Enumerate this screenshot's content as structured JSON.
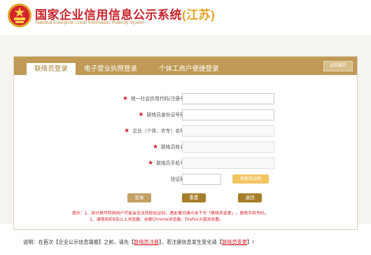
{
  "header": {
    "title_main": "国家企业信用信息公示系统",
    "title_province": "(江苏)",
    "subtitle_en": "National Enterprise Credit Information Publicity System"
  },
  "tabs": [
    {
      "label": "联络员登录"
    },
    {
      "label": "电子营业执照登录"
    },
    {
      "label": "个体工商户便捷登录"
    }
  ],
  "home_button": "返回首页",
  "form": {
    "fields": [
      {
        "label": "统一社会信用代码/注册号",
        "required": true,
        "value": ""
      },
      {
        "label": "联络员身份证号码",
        "required": true,
        "value": ""
      },
      {
        "label": "企业（个体、农专）名称",
        "required": true,
        "value": ""
      },
      {
        "label": "联络员姓名",
        "required": true,
        "value": ""
      },
      {
        "label": "联络员手机号",
        "required": true,
        "value": ""
      }
    ],
    "captcha_label": "验证码",
    "captcha_value": "",
    "get_code_button": "获取验证码",
    "required_mark": "★"
  },
  "actions": {
    "login": "登录",
    "reset": "重置",
    "back": "返回"
  },
  "tips": {
    "line1": "提示：1、部分携号转网用户可能会无法获取验证码，遇此情况请点击下方「联络员变更」，更换手机号码。",
    "line2": "2、请使用IE8及以上浏览器，谷歌Chrome浏览器，Firefox火狐浏览器。"
  },
  "footer": {
    "prefix": "说明：在首次【企业公示信息填报】之前，请先【",
    "link1": "联络员注册",
    "middle": "】，若注册信息发生变化请【",
    "link2": "联络员变更",
    "suffix": "】!"
  },
  "colors": {
    "brand_red": "#c8242b",
    "province_gold": "#e3a32a",
    "tab_bar": "#c09a56",
    "button_gold": "#c3a064",
    "button_dark": "#a77e2b",
    "getcode_yellow": "#f3c562"
  }
}
